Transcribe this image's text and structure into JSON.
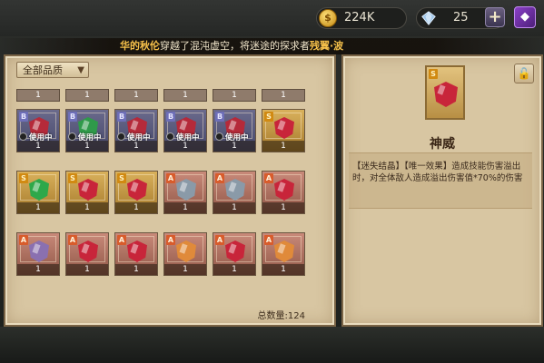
{
  "topbar": {
    "gold": {
      "icon": "gold-coin-icon",
      "symbol": "$",
      "value": "224K"
    },
    "gems": {
      "icon": "diamond-icon",
      "value": "25"
    },
    "plus_label": "+",
    "menu_icon_glyph": "◆"
  },
  "marquee": {
    "name_partial": "华的秋伦",
    "text1": "穿越了混沌虚空，将迷途的探求者",
    "highlight2": "残翼",
    "text2": "·波"
  },
  "inventory": {
    "filter_label": "全部品质",
    "filter_chevron": "▼",
    "total_label": "总数量:124",
    "top_row_counts": [
      "1",
      "1",
      "1",
      "1",
      "1",
      "1"
    ],
    "rows": [
      [
        {
          "rarity": "B",
          "color": "#b52a3a",
          "in_use": true,
          "in_use_label": "使用中",
          "count": "1"
        },
        {
          "rarity": "B",
          "color": "#2f9a4a",
          "in_use": true,
          "in_use_label": "使用中",
          "count": "1"
        },
        {
          "rarity": "B",
          "color": "#b52a3a",
          "in_use": true,
          "in_use_label": "使用中",
          "count": "1"
        },
        {
          "rarity": "B",
          "color": "#b52a3a",
          "in_use": true,
          "in_use_label": "使用中",
          "count": "1"
        },
        {
          "rarity": "B",
          "color": "#b52a3a",
          "in_use": true,
          "in_use_label": "使用中",
          "count": "1"
        },
        {
          "rarity": "S",
          "color": "#c8253a",
          "in_use": false,
          "count": "1"
        }
      ],
      [
        {
          "rarity": "S",
          "color": "#2ea84a",
          "in_use": false,
          "count": "1"
        },
        {
          "rarity": "S",
          "color": "#c8253a",
          "in_use": false,
          "count": "1"
        },
        {
          "rarity": "S",
          "color": "#c8253a",
          "in_use": false,
          "count": "1"
        },
        {
          "rarity": "A",
          "color": "#8a9aa8",
          "in_use": false,
          "count": "1"
        },
        {
          "rarity": "A",
          "color": "#8a9aa8",
          "in_use": false,
          "count": "1"
        },
        {
          "rarity": "A",
          "color": "#c8253a",
          "in_use": false,
          "count": "1"
        }
      ],
      [
        {
          "rarity": "A",
          "color": "#8a70b0",
          "in_use": false,
          "count": "1"
        },
        {
          "rarity": "A",
          "color": "#c8253a",
          "in_use": false,
          "count": "1"
        },
        {
          "rarity": "A",
          "color": "#c8253a",
          "in_use": false,
          "count": "1"
        },
        {
          "rarity": "A",
          "color": "#e08a3a",
          "in_use": false,
          "count": "1"
        },
        {
          "rarity": "A",
          "color": "#c8253a",
          "in_use": false,
          "count": "1"
        },
        {
          "rarity": "A",
          "color": "#e08a3a",
          "in_use": false,
          "count": "1"
        }
      ]
    ]
  },
  "detail": {
    "rarity": "S",
    "crystal_color": "#c8253a",
    "lock_icon": "lock-icon",
    "lock_glyph": "🔓",
    "name": "神威",
    "description": "【迷失结晶】【唯一效果】造成技能伤害溢出时，对全体敌人造成溢出伤害值*70%的伤害"
  }
}
